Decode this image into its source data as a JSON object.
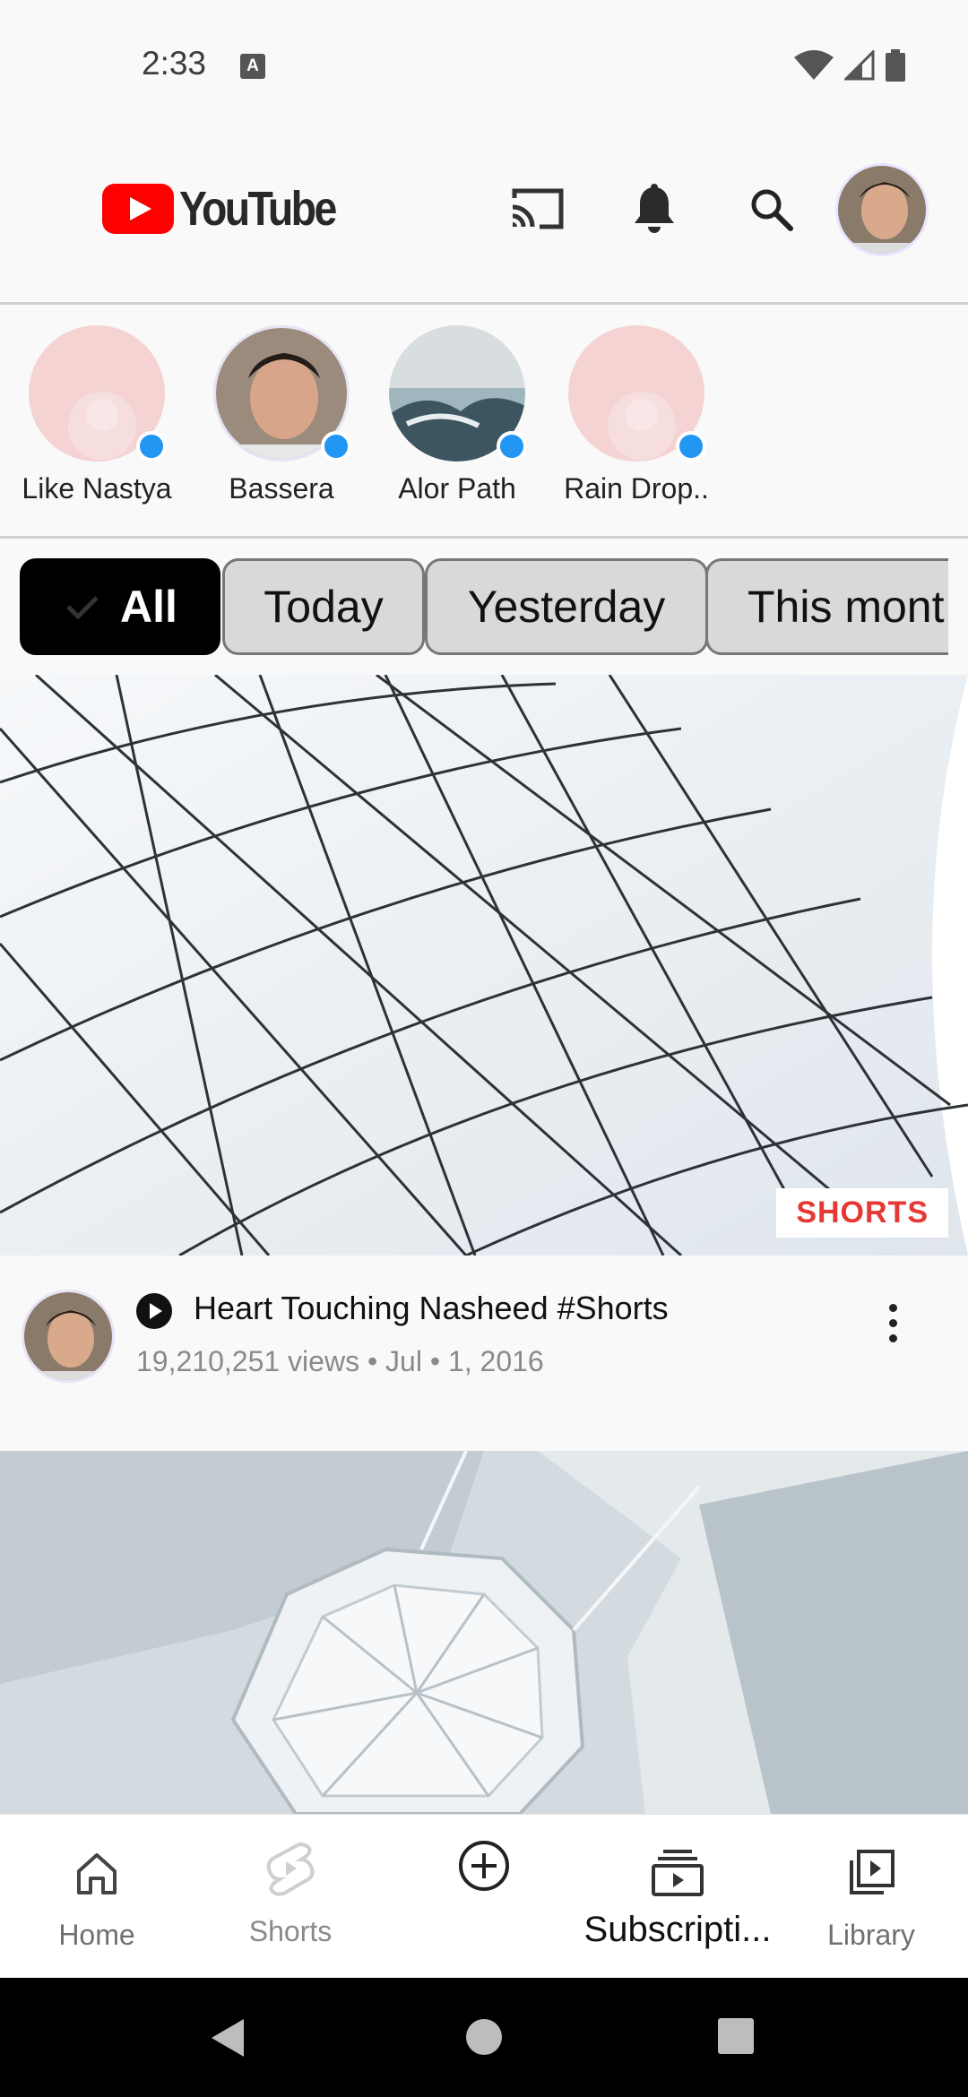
{
  "status_bar": {
    "time": "2:33",
    "notification_icon": "A"
  },
  "app_bar": {
    "logo_text": "YouTube"
  },
  "stories": [
    {
      "name": "Like Nastya"
    },
    {
      "name": "Bassera"
    },
    {
      "name": "Alor Path"
    },
    {
      "name": "Rain Drop.."
    }
  ],
  "chips": [
    {
      "label": "All"
    },
    {
      "label": "Today"
    },
    {
      "label": "Yesterday"
    },
    {
      "label": "This mont"
    }
  ],
  "video1": {
    "badge": "SHORTS",
    "title": "Heart Touching Nasheed #Shorts",
    "subtitle": "19,210,251 views • Jul • 1, 2016"
  },
  "bottom_nav": [
    {
      "label": "Home"
    },
    {
      "label": "Shorts"
    },
    {
      "label": ""
    },
    {
      "label": "Subscripti..."
    },
    {
      "label": "Library"
    }
  ],
  "colors": {
    "brand_red": "#ff0000",
    "accent_blue": "#2196f3",
    "badge_red": "#e53935"
  }
}
